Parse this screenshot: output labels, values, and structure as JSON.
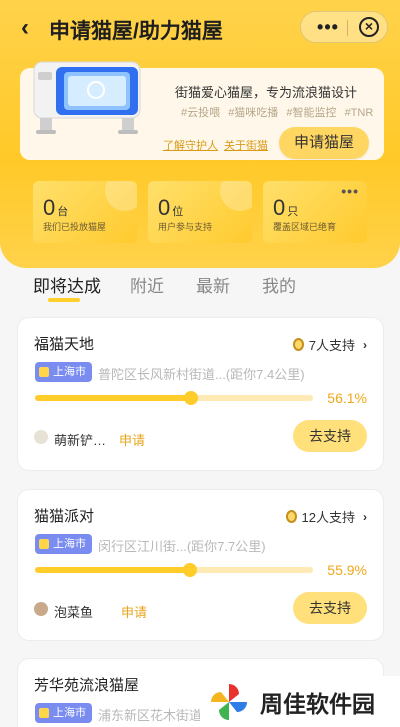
{
  "header": {
    "title": "申请猫屋/助力猫屋",
    "more_icon": "more-dots-icon",
    "close_icon": "close-circle-icon",
    "back_icon": "back-arrow-icon"
  },
  "intro": {
    "tagline": "街猫爱心猫屋，专为流浪猫设计",
    "tags": [
      "#云投喂",
      "#猫咪吃播",
      "#智能监控",
      "#TNR"
    ],
    "links": {
      "guardian": "了解守护人",
      "about": "关于街猫"
    },
    "apply_button": "申请猫屋"
  },
  "stats": [
    {
      "num": "0",
      "unit": "台",
      "label": "我们已投放猫屋"
    },
    {
      "num": "0",
      "unit": "位",
      "label": "用户参与支持"
    },
    {
      "num": "0",
      "unit": "只",
      "label": "覆盖区域已绝育"
    }
  ],
  "tabs": [
    "即将达成",
    "附近",
    "最新",
    "我的"
  ],
  "active_tab": 0,
  "items": [
    {
      "name": "福猫天地",
      "support": "7人支持",
      "city": "上海市",
      "address": "普陀区长风新村街道...(距你7.4公里)",
      "percent": "56.1%",
      "progress": 0.561,
      "user": "萌新铲…",
      "role": "申请",
      "button": "去支持"
    },
    {
      "name": "猫猫派对",
      "support": "12人支持",
      "city": "上海市",
      "address": "闵行区江川街...(距你7.7公里)",
      "percent": "55.9%",
      "progress": 0.559,
      "user": "泡菜鱼",
      "role": "申请",
      "button": "去支持"
    },
    {
      "name": "芳华苑流浪猫屋",
      "city": "上海市",
      "address": "浦东新区花木街道"
    }
  ],
  "watermark": {
    "text": "周佳软件园"
  },
  "colors": {
    "accent": "#ffcc2a",
    "city_badge": "#7a8cf0",
    "percent": "#f0a71a",
    "role": "#e6a61b"
  }
}
